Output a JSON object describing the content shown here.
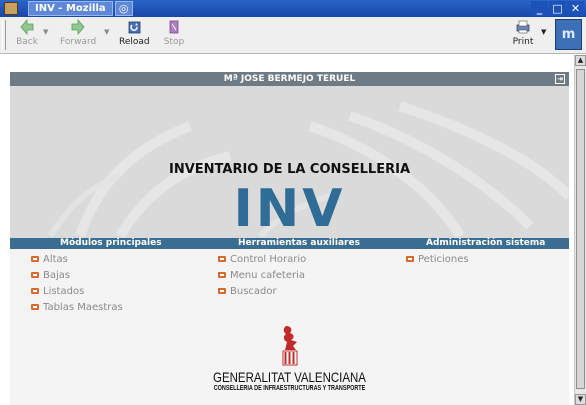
{
  "window": {
    "title": "INV - Mozilla",
    "tab2_icon": "swirl-icon"
  },
  "toolbar": {
    "back": "Back",
    "forward": "Forward",
    "reload": "Reload",
    "stop": "Stop",
    "print": "Print",
    "throbber": "m"
  },
  "page": {
    "user": "Mª JOSE BERMEJO TERUEL",
    "heading": "INVENTARIO DE LA CONSELLERIA",
    "logo": "INV",
    "sections": [
      {
        "title": "Módulos principales",
        "links": [
          "Altas",
          "Bajas",
          "Listados",
          "Tablas Maestras"
        ]
      },
      {
        "title": "Herramientas auxiliares",
        "links": [
          "Control Horario",
          "Menu cafeteria",
          "Buscador"
        ]
      },
      {
        "title": "Administración sistema",
        "links": [
          "Peticiones"
        ]
      }
    ],
    "footer": {
      "name": "GENERALITAT VALENCIANA",
      "sub": "CONSELLERIA DE INFRAESTRUCTURAS Y TRANSPORTE"
    }
  },
  "colors": {
    "titlebar": "#1f56b8",
    "userbar": "#6f7b84",
    "section_bar": "#3a6d92",
    "logo": "#2f6d97",
    "link_icon": "#d86a2e"
  }
}
